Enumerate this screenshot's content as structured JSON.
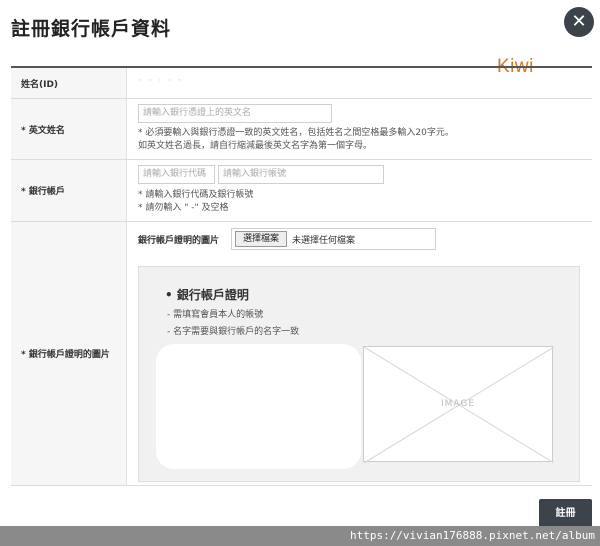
{
  "dialog": {
    "title": "註冊銀行帳戶資料",
    "close_icon": "✕",
    "submit_label": "註冊"
  },
  "fields": {
    "id": {
      "label": "姓名(ID)",
      "value": "· · · · ·"
    },
    "english_name": {
      "label": "* 英文姓名",
      "placeholder": "請輸入銀行憑證上的英文名",
      "note1": "* 必須要輸入與銀行憑證一致的英文姓名，包括姓名之間空格最多輸入20字元。",
      "note2": "如英文姓名過長，請自行縮減最後英文名字為第一個字母。"
    },
    "bank_account": {
      "label": "* 銀行帳戶",
      "code_placeholder": "請輸入銀行代碼",
      "account_placeholder": "請輸入銀行帳號",
      "note1": "* 請輸入銀行代碼及銀行帳號",
      "note2": "* 請勿輸入 \" -\" 及空格"
    },
    "proof_image": {
      "label": "* 銀行帳戶證明的圖片",
      "file_label": "銀行帳戶證明的圖片",
      "choose_button": "選擇檔案",
      "file_status": "未選擇任何檔案",
      "panel_title": "• 銀行帳戶證明",
      "panel_note1": "- 需填寫會員本人的帳號",
      "panel_note2": "- 名字需要與銀行帳戶的名字一致",
      "image_placeholder": "IMAGE"
    }
  },
  "overlay": {
    "brand": "Kiwi",
    "watermark": "https://vivian176888.pixnet.net/album",
    "brand_color": "#d6781f"
  }
}
